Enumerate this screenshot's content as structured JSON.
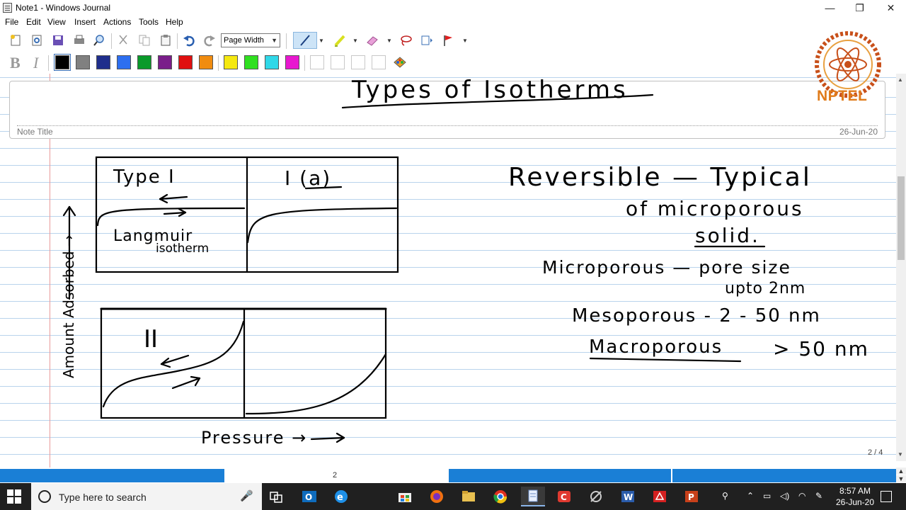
{
  "window": {
    "title": "Note1 - Windows Journal",
    "minimize": "—",
    "maximize": "❐",
    "close": "✕"
  },
  "menu": [
    "File",
    "Edit",
    "View",
    "Insert",
    "Actions",
    "Tools",
    "Help"
  ],
  "toolbar": {
    "zoom_value": "Page Width",
    "bold": "B",
    "italic": "I"
  },
  "colors": {
    "palette": [
      "#000000",
      "#808080",
      "#1f2e8c",
      "#2d6ff0",
      "#0a9a2a",
      "#7a1e8a",
      "#e01010",
      "#f08c10",
      "#f5e810",
      "#30e020",
      "#30d8e8",
      "#e818d0"
    ],
    "selected_palette_color": "#000000",
    "accent": "#1a7fd6",
    "logo_orange": "#e07b1a"
  },
  "note": {
    "title_label": "Note Title",
    "date": "26-Jun-20",
    "page_indicator": "2 / 4",
    "handwriting": {
      "heading": "Types of Isotherms",
      "box1_label": "Type I",
      "box1_caption_line1": "Langmuir",
      "box1_caption_line2": "isotherm",
      "box2_label": "I (a)",
      "box3_label": "II",
      "y_axis": "Amount Adsorbed →",
      "x_axis": "Pressure →",
      "note_line1": "Reversible — Typical",
      "note_line2": "of microporous",
      "note_line3": "solid.",
      "micro_line1": "Microporous — pore size",
      "micro_line2": "upto 2nm",
      "meso": "Mesoporous - 2 - 50 nm",
      "macro_label": "Macroporous",
      "macro_value": "> 50 nm"
    }
  },
  "scrollbar": {
    "page_number": "2"
  },
  "logo": {
    "text": "NPTEL"
  },
  "taskbar": {
    "search_placeholder": "Type here to search",
    "apps": [
      "task-view",
      "outlook",
      "edge",
      "store",
      "firefox",
      "explorer",
      "chrome",
      "windows-journal",
      "app-red",
      "app-tool",
      "word",
      "acrobat",
      "powerpoint"
    ],
    "time": "8:57 AM",
    "date": "26-Jun-20"
  }
}
